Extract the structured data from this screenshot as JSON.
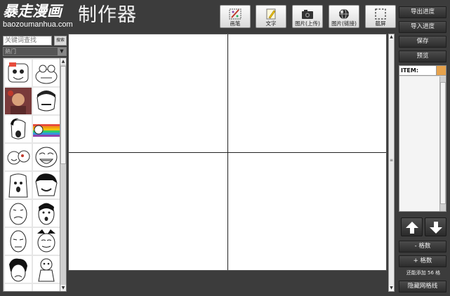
{
  "header": {
    "brand": "暴走漫画",
    "domain": "baozoumanhua.com",
    "app_title": "制作器"
  },
  "toolbar": [
    {
      "key": "brush",
      "label": "画笔",
      "icon": "brush-icon"
    },
    {
      "key": "text",
      "label": "文字",
      "icon": "text-pencil-icon"
    },
    {
      "key": "image_upload",
      "label": "图片(上传)",
      "icon": "camera-icon"
    },
    {
      "key": "image_link",
      "label": "图片(链接)",
      "icon": "globe-icon"
    },
    {
      "key": "screenshot",
      "label": "截屏",
      "icon": "crop-dashed-icon"
    }
  ],
  "left_panel": {
    "search_placeholder": "关键词查找",
    "search_button": "搜索",
    "category_selected": "熱门"
  },
  "right_panel": {
    "export_progress": "导出进度",
    "import_progress": "导入进度",
    "save": "保存",
    "preview": "预览",
    "item_header": "ITEM:",
    "remove_grid": "- 格数",
    "add_grid": "+ 格数",
    "remaining": "还能添加 56 格",
    "hide_grid": "隐藏网格线"
  },
  "colors": {
    "background": "#3c3c3c",
    "canvas": "#ffffff",
    "side_button": "#3a3a3a",
    "lock_accent": "#e6a24c"
  }
}
